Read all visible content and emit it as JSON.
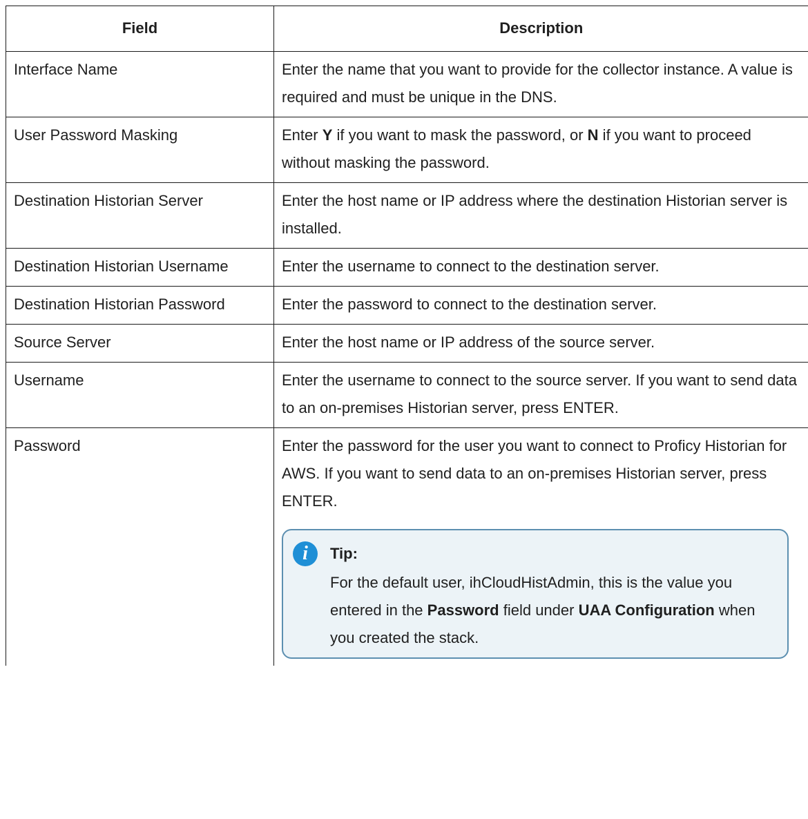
{
  "table": {
    "headers": {
      "field": "Field",
      "description": "Description"
    },
    "rows": [
      {
        "field": "Interface Name",
        "description": "Enter the name that you want to provide for the collector in­stance. A value is required and must be unique in the DNS."
      },
      {
        "field": "User Password Masking",
        "desc_parts": [
          "Enter ",
          "Y",
          " if you want to mask the password, or ",
          "N",
          " if you want to proceed without masking the password."
        ]
      },
      {
        "field": "Destination Historian Server",
        "description": "Enter the host name or IP address where the destination Histori­an server is installed."
      },
      {
        "field": "Destination Historian User­name",
        "description": "Enter the username to connect to the destination server."
      },
      {
        "field": "Destination Historian Pass­word",
        "description": "Enter the password to connect to the destination server."
      },
      {
        "field": "Source Server",
        "description": "Enter the host name or IP address of the source server."
      },
      {
        "field": "Username",
        "description": "Enter the username to connect to the source server. If you want to send data to an on-premises Historian server, press ENTER."
      },
      {
        "field": "Password",
        "description": "Enter the password for the user you want to connect to Proficy Historian for AWS. If you want to send data to an on-premises Historian server, press ENTER.",
        "tip": {
          "icon": "info-icon",
          "icon_glyph": "i",
          "label": "Tip:",
          "parts": [
            "For the default user, ihCloudHistAdmin, this is the value you entered in the ",
            "Password",
            " field under ",
            "UAA Configu­ration",
            " when you created the stack."
          ]
        }
      }
    ]
  }
}
